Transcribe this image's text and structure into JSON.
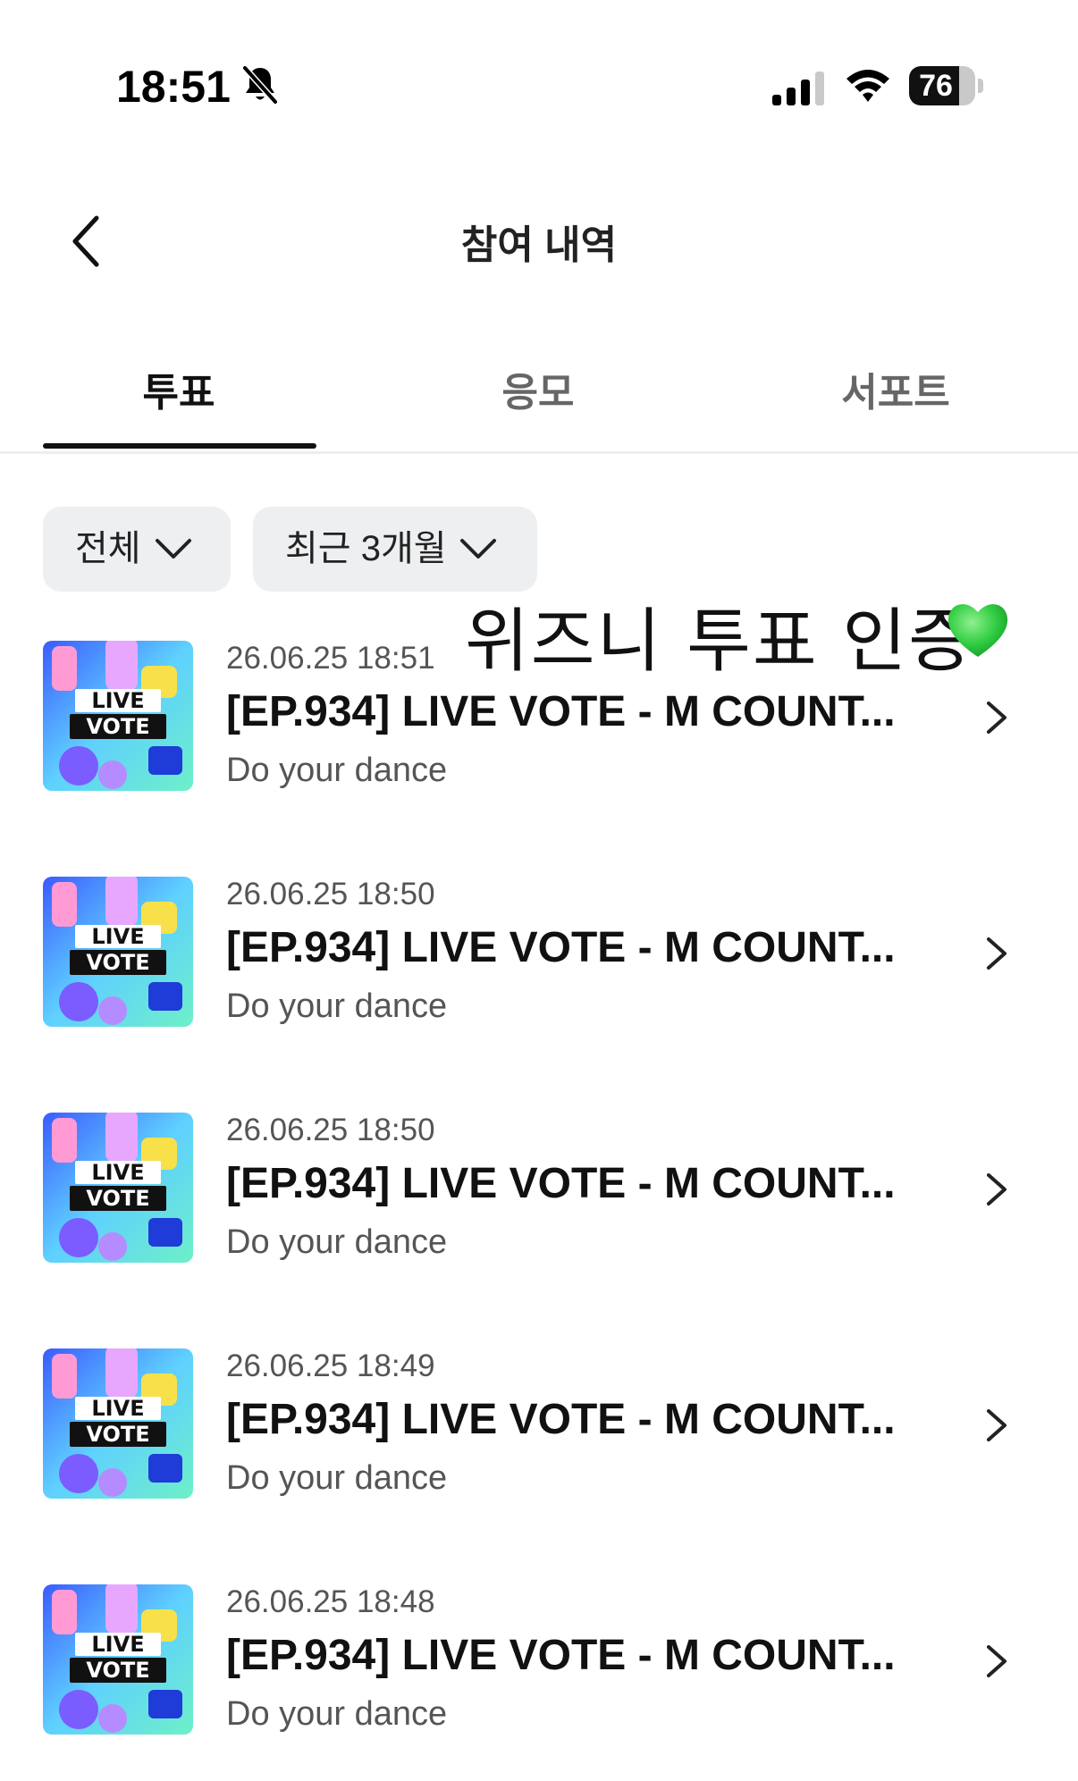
{
  "status_bar": {
    "time": "18:51",
    "battery": "76",
    "battery_level": 0.76,
    "icons": [
      "bell-slash-icon",
      "signal-icon",
      "wifi-icon",
      "battery-icon"
    ]
  },
  "header": {
    "title": "참여 내역",
    "back_icon": "chevron-left-icon"
  },
  "tabs": [
    {
      "label": "투표",
      "active": true
    },
    {
      "label": "응모",
      "active": false
    },
    {
      "label": "서포트",
      "active": false
    }
  ],
  "filters": [
    {
      "label": "전체"
    },
    {
      "label": "최근 3개월"
    }
  ],
  "overlay": {
    "caption": "위즈니 투표 인증",
    "emoji": "green-heart-icon"
  },
  "items": [
    {
      "date": "26.06.25 18:51",
      "title": "[EP.934] LIVE VOTE - M COUNT...",
      "subtitle": "Do your dance",
      "thumb_text": [
        "LIVE",
        "VOTE"
      ]
    },
    {
      "date": "26.06.25 18:50",
      "title": "[EP.934] LIVE VOTE - M COUNT...",
      "subtitle": "Do your dance",
      "thumb_text": [
        "LIVE",
        "VOTE"
      ]
    },
    {
      "date": "26.06.25 18:50",
      "title": "[EP.934] LIVE VOTE - M COUNT...",
      "subtitle": "Do your dance",
      "thumb_text": [
        "LIVE",
        "VOTE"
      ]
    },
    {
      "date": "26.06.25 18:49",
      "title": "[EP.934] LIVE VOTE - M COUNT...",
      "subtitle": "Do your dance",
      "thumb_text": [
        "LIVE",
        "VOTE"
      ]
    },
    {
      "date": "26.06.25 18:48",
      "title": "[EP.934] LIVE VOTE - M COUNT...",
      "subtitle": "Do your dance",
      "thumb_text": [
        "LIVE",
        "VOTE"
      ]
    }
  ],
  "colors": {
    "active_text": "#111111",
    "inactive_text": "#666666",
    "chip_bg": "#eeeff1",
    "heart": "#2ecc40"
  }
}
